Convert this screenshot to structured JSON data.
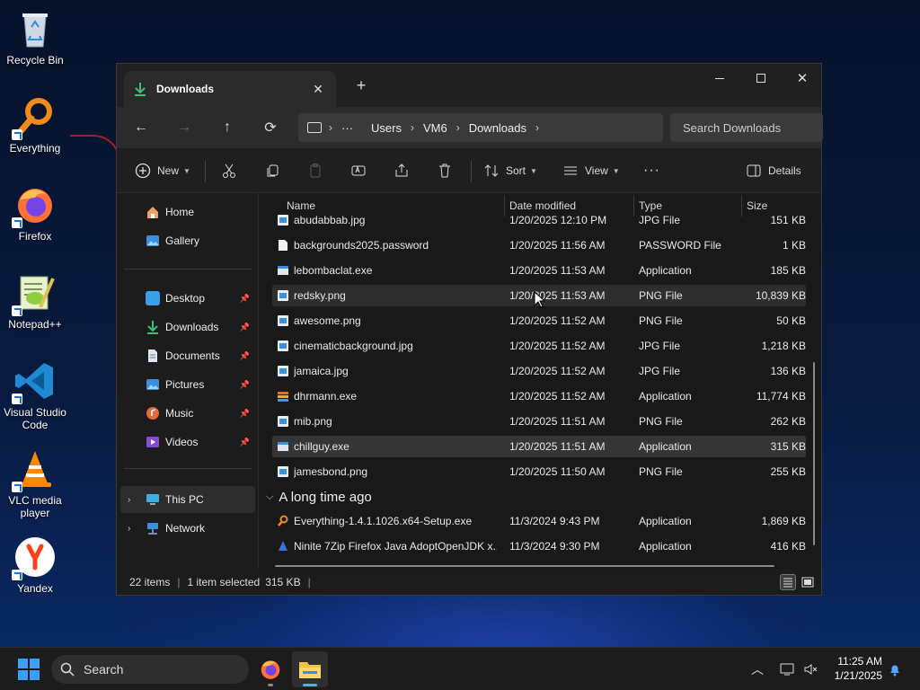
{
  "desktop": {
    "icons": [
      {
        "label": "Recycle Bin",
        "icon": "recycle-bin-icon"
      },
      {
        "label": "Everything",
        "icon": "everything-icon"
      },
      {
        "label": "Firefox",
        "icon": "firefox-icon"
      },
      {
        "label": "Notepad++",
        "icon": "notepad-plus-plus-icon"
      },
      {
        "label": "Visual Studio Code",
        "icon": "vscode-icon"
      },
      {
        "label": "VLC media player",
        "icon": "vlc-icon"
      },
      {
        "label": "Yandex",
        "icon": "yandex-icon"
      }
    ]
  },
  "window": {
    "tab_title": "Downloads",
    "new_tab": "+",
    "address": {
      "segments": [
        "Users",
        "VM6",
        "Downloads"
      ],
      "ellipsis": "···"
    },
    "search_placeholder": "Search Downloads",
    "toolbar": {
      "new_label": "New",
      "sort_label": "Sort",
      "view_label": "View",
      "more_label": "···",
      "details_label": "Details"
    },
    "sidebar": {
      "home": "Home",
      "gallery": "Gallery",
      "desktop": "Desktop",
      "downloads": "Downloads",
      "documents": "Documents",
      "pictures": "Pictures",
      "music": "Music",
      "videos": "Videos",
      "this_pc": "This PC",
      "network": "Network"
    },
    "columns": {
      "name": "Name",
      "date": "Date modified",
      "type": "Type",
      "size": "Size"
    },
    "files": [
      {
        "name": "abudabbab.jpg",
        "date": "1/20/2025 12:10 PM",
        "type": "JPG File",
        "size": "151 KB",
        "icon": "image-file-icon"
      },
      {
        "name": "backgrounds2025.password",
        "date": "1/20/2025 11:56 AM",
        "type": "PASSWORD File",
        "size": "1 KB",
        "icon": "blank-file-icon"
      },
      {
        "name": "lebombaclat.exe",
        "date": "1/20/2025 11:53 AM",
        "type": "Application",
        "size": "185 KB",
        "icon": "app-file-icon"
      },
      {
        "name": "redsky.png",
        "date": "1/20/2025 11:53 AM",
        "type": "PNG File",
        "size": "10,839 KB",
        "icon": "image-file-icon"
      },
      {
        "name": "awesome.png",
        "date": "1/20/2025 11:52 AM",
        "type": "PNG File",
        "size": "50 KB",
        "icon": "image-file-icon"
      },
      {
        "name": "cinematicbackground.jpg",
        "date": "1/20/2025 11:52 AM",
        "type": "JPG File",
        "size": "1,218 KB",
        "icon": "image-file-icon"
      },
      {
        "name": "jamaica.jpg",
        "date": "1/20/2025 11:52 AM",
        "type": "JPG File",
        "size": "136 KB",
        "icon": "image-file-icon"
      },
      {
        "name": "dhrmann.exe",
        "date": "1/20/2025 11:52 AM",
        "type": "Application",
        "size": "11,774 KB",
        "icon": "installer-file-icon"
      },
      {
        "name": "mib.png",
        "date": "1/20/2025 11:51 AM",
        "type": "PNG File",
        "size": "262 KB",
        "icon": "image-file-icon"
      },
      {
        "name": "chillguy.exe",
        "date": "1/20/2025 11:51 AM",
        "type": "Application",
        "size": "315 KB",
        "icon": "app-file-icon"
      },
      {
        "name": "jamesbond.png",
        "date": "1/20/2025 11:50 AM",
        "type": "PNG File",
        "size": "255 KB",
        "icon": "image-file-icon"
      }
    ],
    "group_label": "A long time ago",
    "old_files": [
      {
        "name": "Everything-1.4.1.1026.x64-Setup.exe",
        "date": "11/3/2024 9:43 PM",
        "type": "Application",
        "size": "1,869 KB",
        "icon": "everything-icon"
      },
      {
        "name": "Ninite 7Zip Firefox Java AdoptOpenJDK x...",
        "date": "11/3/2024 9:30 PM",
        "type": "Application",
        "size": "416 KB",
        "icon": "ninite-icon"
      }
    ],
    "status": {
      "items": "22 items",
      "selected": "1 item selected",
      "size": "315 KB"
    }
  },
  "taskbar": {
    "search_placeholder": "Search",
    "time": "11:25 AM",
    "date": "1/21/2025"
  },
  "colors": {
    "accent": "#58a6ff",
    "window_bg": "#1c1c1c",
    "selection": "#353535"
  }
}
